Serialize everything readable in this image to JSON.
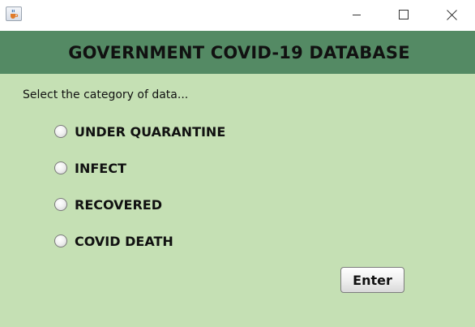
{
  "window": {
    "header_title": "GOVERNMENT COVID-19 DATABASE",
    "controls": [
      "minimize-icon",
      "maximize-icon",
      "close-icon"
    ],
    "app_icon": "java-cup-icon"
  },
  "form": {
    "prompt": "Select the category of data...",
    "options": [
      {
        "label": "UNDER QUARANTINE",
        "selected": false
      },
      {
        "label": "INFECT",
        "selected": false
      },
      {
        "label": "RECOVERED",
        "selected": false
      },
      {
        "label": "COVID DEATH",
        "selected": false
      }
    ],
    "submit_label": "Enter"
  },
  "colors": {
    "header_band": "#548a64",
    "panel_background": "#c5e0b4",
    "titlebar": "#ffffff"
  }
}
